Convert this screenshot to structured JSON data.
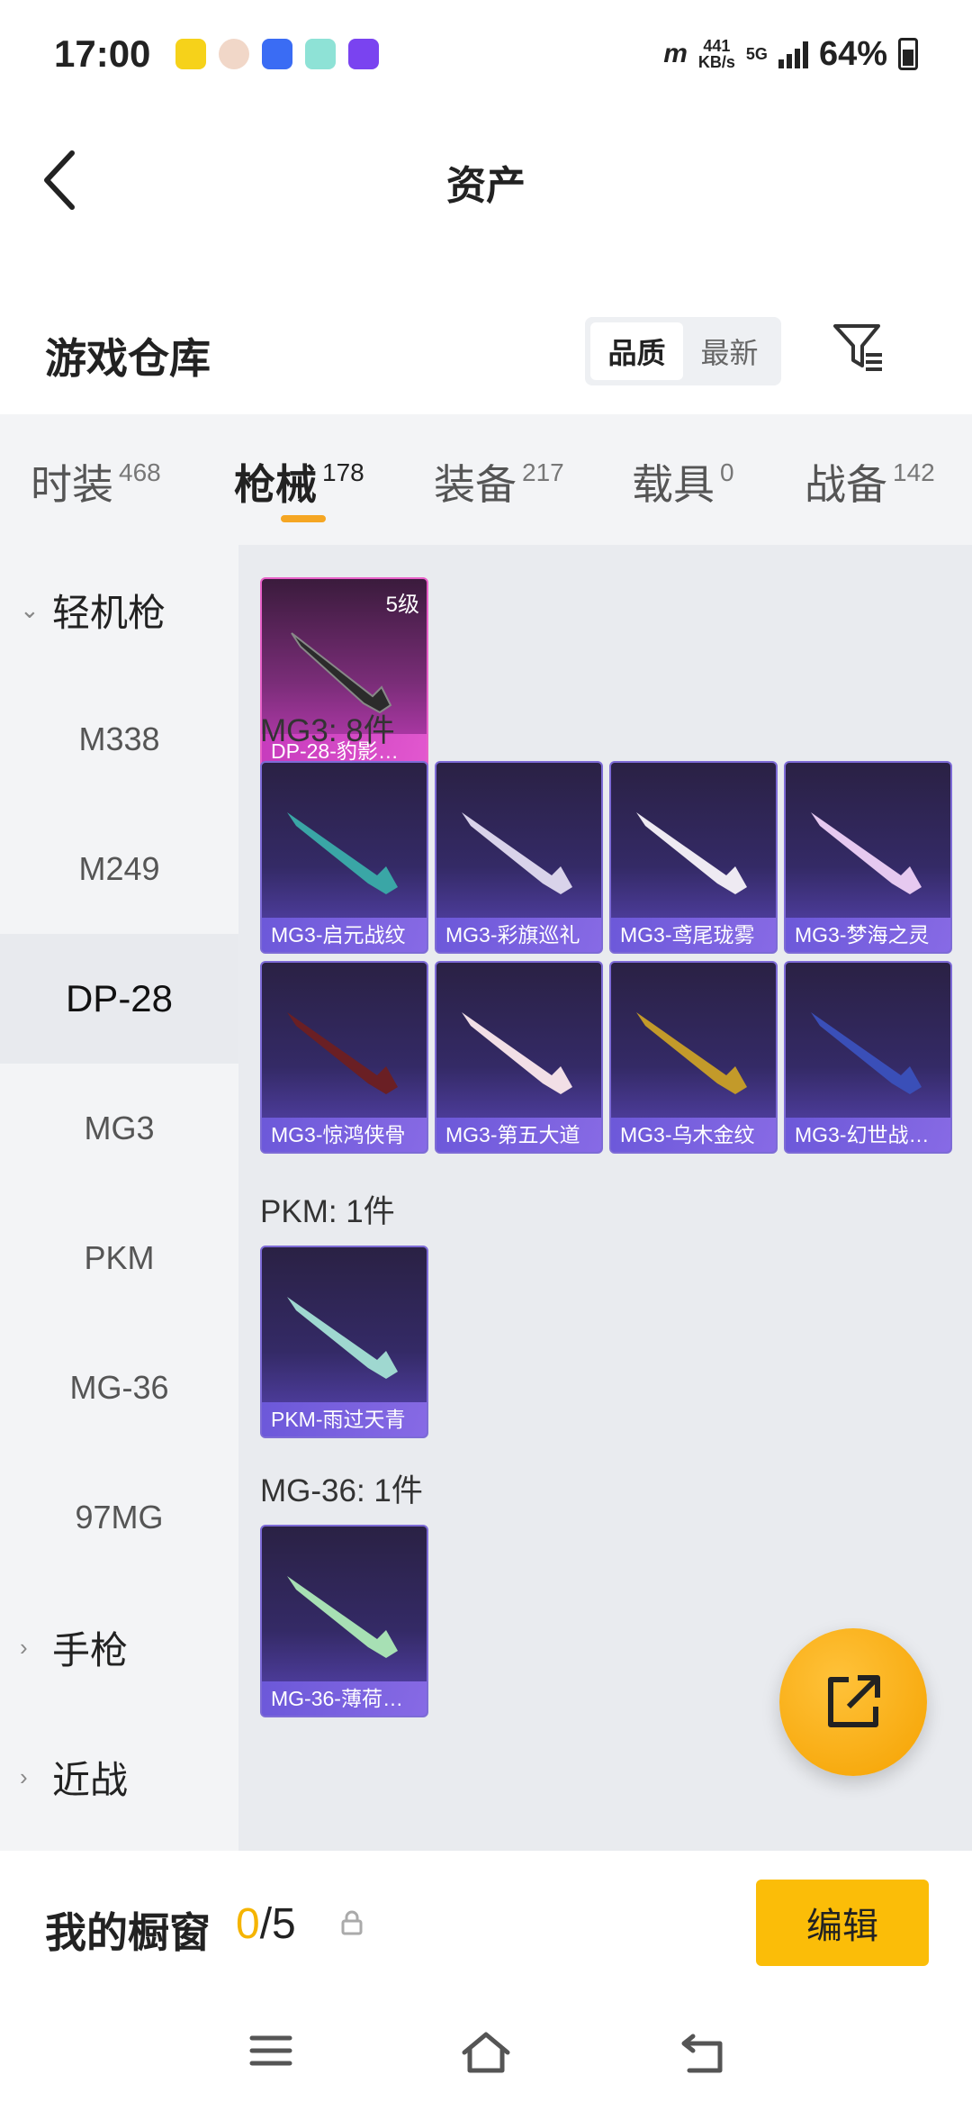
{
  "status_bar": {
    "time": "17:00",
    "net_speed": "441",
    "net_unit": "KB/s",
    "network": "5G",
    "battery": "64%"
  },
  "header": {
    "title": "资产",
    "back_icon": "chevron-left-icon"
  },
  "warehouse": {
    "title": "游戏仓库",
    "sort_options": [
      "品质",
      "最新"
    ],
    "selected_sort": "品质",
    "filter_icon": "filter-icon"
  },
  "tabs": [
    {
      "label": "时装",
      "count": "468"
    },
    {
      "label": "枪械",
      "count": "178"
    },
    {
      "label": "装备",
      "count": "217"
    },
    {
      "label": "载具",
      "count": "0"
    },
    {
      "label": "战备",
      "count": "142"
    }
  ],
  "active_tab": "枪械",
  "sidebar": {
    "category_open": "轻机枪",
    "items": [
      "M338",
      "M249",
      "DP-28",
      "MG3",
      "PKM",
      "MG-36",
      "97MG"
    ],
    "selected": "DP-28",
    "category_collapsed_1": "手枪",
    "category_collapsed_2": "近战"
  },
  "content": {
    "dp28_card": {
      "level": "5级",
      "name": "DP-28-豹影…"
    },
    "mg3_title": "MG3: 8件",
    "mg3_cards": [
      "MG3-启元战纹",
      "MG3-彩旗巡礼",
      "MG3-鸢尾珑雾",
      "MG3-梦海之灵",
      "MG3-惊鸿侠骨",
      "MG3-第五大道",
      "MG3-乌木金纹",
      "MG3-幻世战…"
    ],
    "pkm_title": "PKM: 1件",
    "pkm_card": "PKM-雨过天青",
    "mg36_title": "MG-36: 1件",
    "mg36_card": "MG-36-薄荷…"
  },
  "fab": {
    "icon": "share-external-icon"
  },
  "bottom": {
    "title": "我的橱窗",
    "current": "0",
    "total": "/5",
    "lock_icon": "lock-icon",
    "edit_label": "编辑"
  },
  "colors": {
    "accent": "#f5a623",
    "button": "#fbbd08",
    "card_purple": "#5a46b8",
    "card_pink": "#c63dbd"
  }
}
